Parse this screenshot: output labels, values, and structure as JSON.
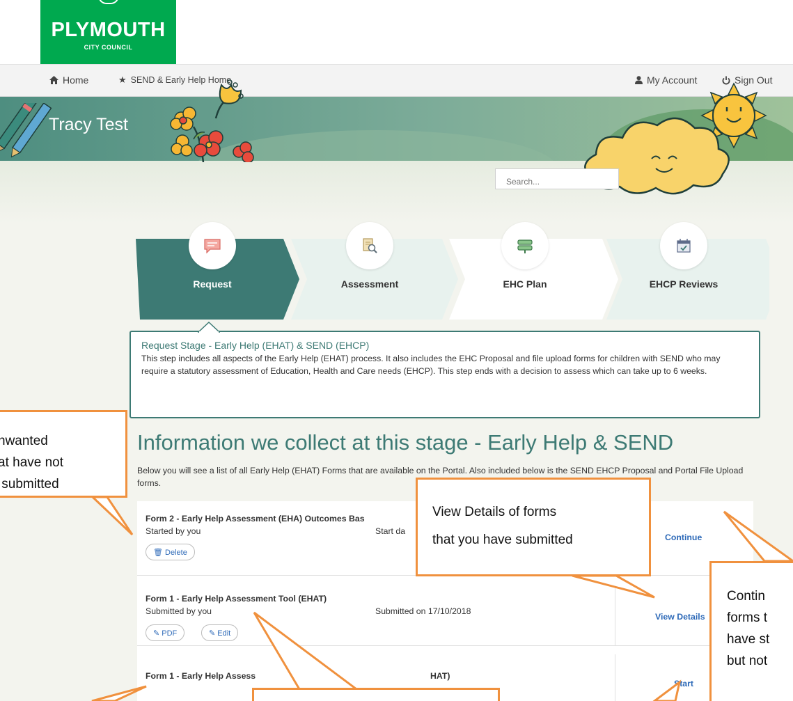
{
  "logo": {
    "name": "PLYMOUTH",
    "sub": "CITY COUNCIL"
  },
  "nav": {
    "home": "Home",
    "send_home": "SEND & Early Help Home",
    "my_account": "My Account",
    "sign_out": "Sign Out",
    "home_icon": "home-icon",
    "star_icon": "star-icon",
    "user_icon": "user-icon",
    "power_icon": "power-icon"
  },
  "banner": {
    "title": "Tracy Test"
  },
  "search": {
    "placeholder": "Search..."
  },
  "steps": [
    {
      "label": "Request",
      "icon": "speech-bubble-icon",
      "active": true
    },
    {
      "label": "Assessment",
      "icon": "document-search-icon",
      "active": false
    },
    {
      "label": "EHC Plan",
      "icon": "signpost-icon",
      "active": false
    },
    {
      "label": "EHCP Reviews",
      "icon": "calendar-check-icon",
      "active": false
    }
  ],
  "stage": {
    "title": "Request Stage - Early Help (EHAT) & SEND (EHCP)",
    "description": "This step includes all aspects of the Early Help (EHAT) process. It also includes the EHC Proposal and file upload forms for children with SEND who may require a statutory assessment of Education, Health and Care needs (EHCP). This step ends with a decision to assess which can take up to 6 weeks."
  },
  "section": {
    "heading": "Information we collect at this stage - Early Help & SEND",
    "intro": "Below you will see a list of all Early Help (EHAT) Forms that are available on the Portal. Also included below is the SEND EHCP Proposal and Portal File Upload forms."
  },
  "forms": [
    {
      "title": "Form 2 - Early Help Assessment (EHA) Outcomes Bas",
      "who": "Started by you",
      "when": "Start da",
      "action": "Continue",
      "buttons": [
        "Delete"
      ]
    },
    {
      "title": "Form 1 - Early Help Assessment Tool (EHAT)",
      "who": "Submitted by you",
      "when": "Submitted on 17/10/2018",
      "action": "View Details",
      "buttons": [
        "PDF",
        "Edit"
      ]
    },
    {
      "title_a": "Form 1 - Early Help Assess",
      "title_b": "HAT)",
      "action": "Start"
    }
  ],
  "callouts": {
    "left": [
      "nwanted",
      "at have not",
      " submitted"
    ],
    "middle": [
      "View Details of forms",
      "that you have submitted"
    ],
    "right": [
      "Contin",
      "forms t",
      "have st",
      "but not"
    ]
  },
  "colors": {
    "brand_green": "#00a94f",
    "accent_teal": "#3d7a74",
    "link_blue": "#2e6ab8",
    "callout_orange": "#f0913e"
  }
}
